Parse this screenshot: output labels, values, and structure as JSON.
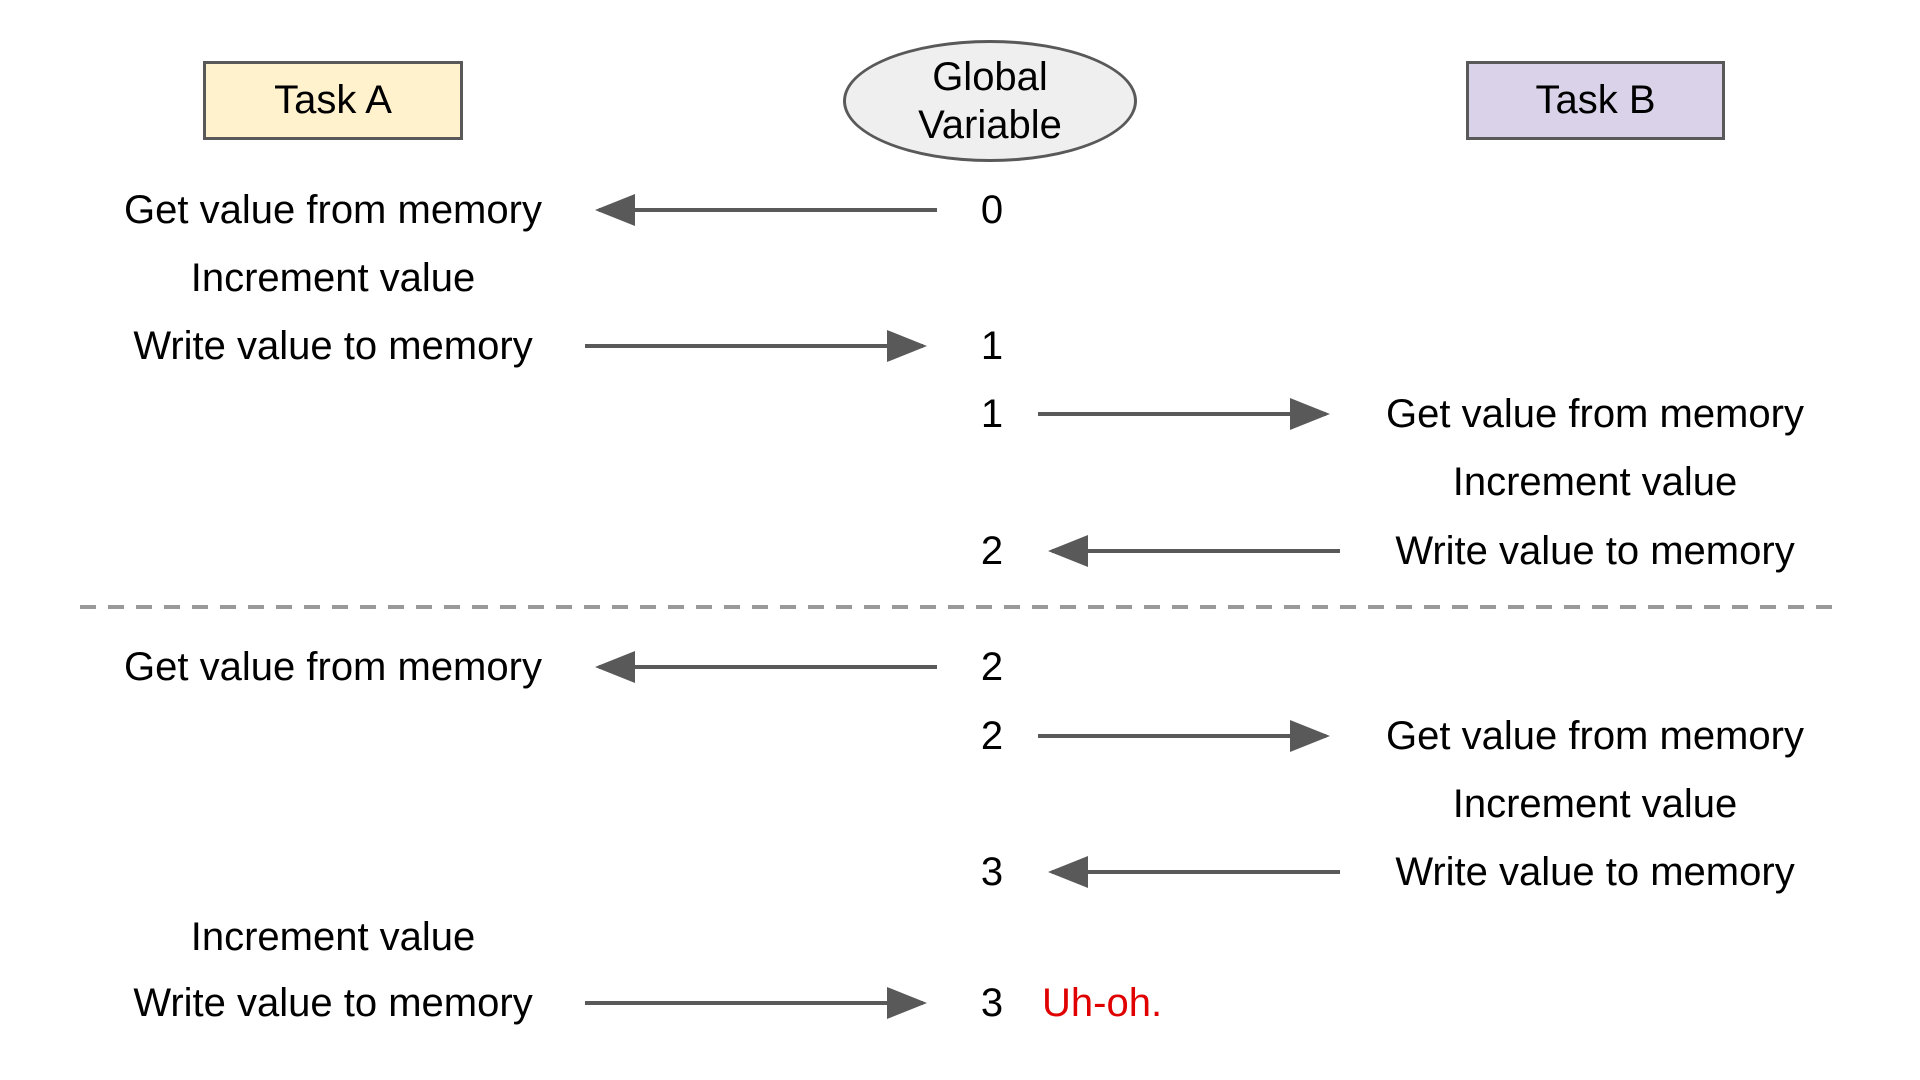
{
  "headers": {
    "task_a": "Task A",
    "global_line1": "Global",
    "global_line2": "Variable",
    "task_b": "Task B"
  },
  "colors": {
    "task_a_fill": "#fff2cc",
    "task_b_fill": "#d9d2e9",
    "global_fill": "#efefef",
    "border": "#595959",
    "arrow": "#595959",
    "separator": "#999999",
    "warning": "#e00000"
  },
  "rows": [
    {
      "task_a": "Get value from memory",
      "value": "0",
      "task_b": "",
      "arrow": "to-a"
    },
    {
      "task_a": "Increment value",
      "value": "",
      "task_b": "",
      "arrow": "none"
    },
    {
      "task_a": "Write value to memory",
      "value": "1",
      "task_b": "",
      "arrow": "to-global-from-a"
    },
    {
      "task_a": "",
      "value": "1",
      "task_b": "Get value from memory",
      "arrow": "to-b"
    },
    {
      "task_a": "",
      "value": "",
      "task_b": "Increment value",
      "arrow": "none"
    },
    {
      "task_a": "",
      "value": "2",
      "task_b": "Write value to memory",
      "arrow": "to-global-from-b"
    },
    {
      "task_a": "Get value from memory",
      "value": "2",
      "task_b": "",
      "arrow": "to-a"
    },
    {
      "task_a": "",
      "value": "2",
      "task_b": "Get value from memory",
      "arrow": "to-b"
    },
    {
      "task_a": "",
      "value": "",
      "task_b": "Increment value",
      "arrow": "none"
    },
    {
      "task_a": "",
      "value": "3",
      "task_b": "Write value to memory",
      "arrow": "to-global-from-b"
    },
    {
      "task_a": "Increment value",
      "value": "",
      "task_b": "",
      "arrow": "none"
    },
    {
      "task_a": "Write value to memory",
      "value": "3",
      "task_b": "",
      "arrow": "to-global-from-a"
    }
  ],
  "annotation": "Uh-oh."
}
